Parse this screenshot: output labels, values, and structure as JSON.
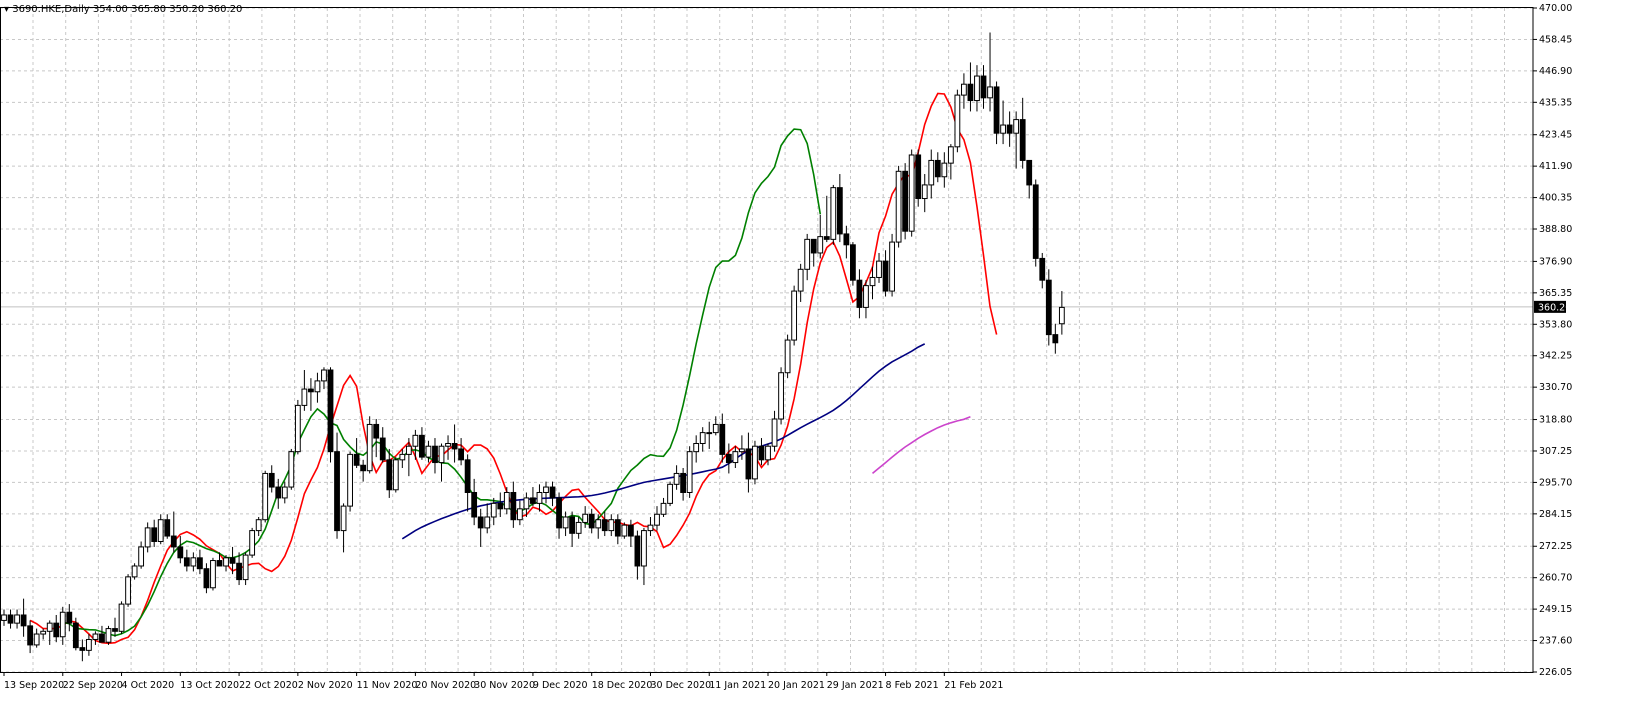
{
  "header": {
    "symbol": "3690.HKE,Daily",
    "ohlc": "354.00 365.80 350.20 360.20"
  },
  "colors": {
    "background": "#ffffff",
    "grid": "#c8c8c8",
    "candle_up_fill": "#ffffff",
    "candle_down_fill": "#000000",
    "candle_stroke": "#000000",
    "ma_fast": "#ff0000",
    "ma_mid": "#008000",
    "ma_slow": "#000080",
    "ma_long": "#cc44cc",
    "price_line": "#c0c0c0",
    "price_label_bg": "#000000",
    "price_label_text": "#ffffff"
  },
  "chart_data": {
    "type": "candlestick",
    "title": "3690.HKE,Daily",
    "ylim": [
      226.05,
      470.0
    ],
    "y_ticks": [
      "470.00",
      "458.45",
      "446.90",
      "435.35",
      "423.45",
      "411.90",
      "400.35",
      "388.80",
      "376.90",
      "365.35",
      "353.80",
      "342.25",
      "330.70",
      "318.80",
      "307.25",
      "295.70",
      "284.15",
      "272.25",
      "260.70",
      "249.15",
      "237.60",
      "226.05"
    ],
    "x_labels": [
      "13 Sep 2020",
      "22 Sep 2020",
      "4 Oct 2020",
      "13 Oct 2020",
      "22 Oct 2020",
      "2 Nov 2020",
      "11 Nov 2020",
      "20 Nov 2020",
      "30 Nov 2020",
      "9 Dec 2020",
      "18 Dec 2020",
      "30 Dec 2020",
      "11 Jan 2021",
      "20 Jan 2021",
      "29 Jan 2021",
      "8 Feb 2021",
      "21 Feb 2021"
    ],
    "x_label_bar_index": [
      0,
      9,
      18,
      27,
      36,
      45,
      54,
      63,
      72,
      81,
      90,
      99,
      108,
      117,
      126,
      135,
      144
    ],
    "current_price": 360.2,
    "grid": true,
    "candles": [
      [
        245,
        249,
        243,
        247
      ],
      [
        247,
        249,
        242,
        244
      ],
      [
        244,
        249,
        242,
        247
      ],
      [
        247,
        253,
        239,
        243
      ],
      [
        243,
        245,
        233,
        236
      ],
      [
        236,
        242,
        235,
        240
      ],
      [
        240,
        242,
        238,
        241
      ],
      [
        241,
        245,
        236,
        244
      ],
      [
        244,
        247,
        237,
        239
      ],
      [
        239,
        250,
        236,
        248
      ],
      [
        248,
        251,
        241,
        244
      ],
      [
        244,
        246,
        234,
        235
      ],
      [
        235,
        238,
        230,
        234
      ],
      [
        234,
        240,
        232,
        238
      ],
      [
        238,
        241,
        236,
        240
      ],
      [
        240,
        243,
        237,
        237
      ],
      [
        237,
        243,
        236,
        242
      ],
      [
        242,
        246,
        239,
        241
      ],
      [
        241,
        252,
        240,
        251
      ],
      [
        251,
        262,
        250,
        261
      ],
      [
        261,
        266,
        260,
        265
      ],
      [
        265,
        274,
        264,
        272
      ],
      [
        272,
        281,
        270,
        279
      ],
      [
        279,
        282,
        272,
        274
      ],
      [
        274,
        284,
        273,
        282
      ],
      [
        282,
        284,
        275,
        276
      ],
      [
        276,
        285,
        270,
        272
      ],
      [
        272,
        276,
        266,
        268
      ],
      [
        268,
        271,
        263,
        265
      ],
      [
        265,
        270,
        263,
        268
      ],
      [
        268,
        271,
        262,
        264
      ],
      [
        264,
        266,
        255,
        257
      ],
      [
        257,
        268,
        256,
        267
      ],
      [
        267,
        270,
        265,
        265
      ],
      [
        265,
        269,
        263,
        268
      ],
      [
        268,
        272,
        262,
        266
      ],
      [
        266,
        270,
        258,
        260
      ],
      [
        260,
        270,
        258,
        269
      ],
      [
        269,
        279,
        268,
        278
      ],
      [
        278,
        283,
        276,
        282
      ],
      [
        282,
        300,
        281,
        299
      ],
      [
        299,
        302,
        292,
        294
      ],
      [
        294,
        297,
        286,
        290
      ],
      [
        290,
        296,
        288,
        294
      ],
      [
        294,
        308,
        293,
        307
      ],
      [
        307,
        326,
        306,
        324
      ],
      [
        324,
        337,
        322,
        330
      ],
      [
        330,
        334,
        322,
        329
      ],
      [
        329,
        336,
        325,
        333
      ],
      [
        333,
        338,
        330,
        337
      ],
      [
        337,
        338,
        303,
        307
      ],
      [
        307,
        314,
        275,
        278
      ],
      [
        278,
        288,
        270,
        287
      ],
      [
        287,
        307,
        285,
        306
      ],
      [
        306,
        312,
        301,
        302
      ],
      [
        302,
        304,
        296,
        300
      ],
      [
        300,
        320,
        299,
        317
      ],
      [
        317,
        319,
        305,
        312
      ],
      [
        312,
        316,
        303,
        304
      ],
      [
        304,
        308,
        290,
        293
      ],
      [
        293,
        305,
        292,
        304
      ],
      [
        304,
        308,
        301,
        306
      ],
      [
        306,
        312,
        298,
        309
      ],
      [
        309,
        315,
        304,
        313
      ],
      [
        313,
        316,
        304,
        305
      ],
      [
        305,
        311,
        303,
        309
      ],
      [
        309,
        312,
        299,
        303
      ],
      [
        303,
        310,
        296,
        309
      ],
      [
        309,
        313,
        304,
        310
      ],
      [
        310,
        317,
        303,
        308
      ],
      [
        308,
        312,
        302,
        304
      ],
      [
        304,
        306,
        285,
        292
      ],
      [
        292,
        297,
        280,
        283
      ],
      [
        283,
        286,
        272,
        279
      ],
      [
        279,
        288,
        277,
        283
      ],
      [
        283,
        290,
        280,
        288
      ],
      [
        288,
        292,
        283,
        286
      ],
      [
        286,
        294,
        284,
        292
      ],
      [
        292,
        296,
        279,
        282
      ],
      [
        282,
        289,
        280,
        286
      ],
      [
        286,
        292,
        283,
        290
      ],
      [
        290,
        294,
        287,
        288
      ],
      [
        288,
        295,
        285,
        292
      ],
      [
        292,
        296,
        288,
        294
      ],
      [
        294,
        296,
        287,
        290
      ],
      [
        290,
        292,
        275,
        279
      ],
      [
        279,
        285,
        276,
        283
      ],
      [
        283,
        285,
        272,
        277
      ],
      [
        277,
        283,
        275,
        281
      ],
      [
        281,
        287,
        279,
        284
      ],
      [
        284,
        286,
        277,
        279
      ],
      [
        279,
        284,
        275,
        282
      ],
      [
        282,
        285,
        276,
        278
      ],
      [
        278,
        284,
        276,
        282
      ],
      [
        282,
        284,
        273,
        276
      ],
      [
        276,
        281,
        275,
        280
      ],
      [
        280,
        282,
        272,
        276
      ],
      [
        276,
        278,
        260,
        265
      ],
      [
        265,
        279,
        258,
        278
      ],
      [
        278,
        283,
        276,
        280
      ],
      [
        280,
        287,
        278,
        284
      ],
      [
        284,
        290,
        283,
        288
      ],
      [
        288,
        296,
        287,
        295
      ],
      [
        295,
        302,
        293,
        299
      ],
      [
        299,
        301,
        289,
        292
      ],
      [
        292,
        309,
        290,
        307
      ],
      [
        307,
        313,
        303,
        310
      ],
      [
        310,
        316,
        307,
        314
      ],
      [
        314,
        318,
        308,
        314
      ],
      [
        314,
        320,
        313,
        317
      ],
      [
        317,
        321,
        303,
        306
      ],
      [
        306,
        310,
        299,
        303
      ],
      [
        303,
        309,
        301,
        307
      ],
      [
        307,
        313,
        304,
        308
      ],
      [
        308,
        314,
        292,
        297
      ],
      [
        297,
        311,
        295,
        309
      ],
      [
        309,
        312,
        302,
        304
      ],
      [
        304,
        310,
        302,
        309
      ],
      [
        309,
        322,
        307,
        319
      ],
      [
        319,
        338,
        317,
        336
      ],
      [
        336,
        350,
        334,
        348
      ],
      [
        348,
        368,
        346,
        366
      ],
      [
        366,
        376,
        362,
        374
      ],
      [
        374,
        387,
        370,
        385
      ],
      [
        385,
        384,
        375,
        380
      ],
      [
        380,
        394,
        378,
        386
      ],
      [
        386,
        401,
        384,
        385
      ],
      [
        385,
        405,
        383,
        404
      ],
      [
        404,
        409,
        384,
        387
      ],
      [
        387,
        390,
        378,
        383
      ],
      [
        383,
        384,
        368,
        370
      ],
      [
        370,
        374,
        356,
        360
      ],
      [
        360,
        370,
        356,
        368
      ],
      [
        368,
        375,
        363,
        371
      ],
      [
        371,
        380,
        369,
        377
      ],
      [
        377,
        381,
        364,
        366
      ],
      [
        366,
        387,
        364,
        384
      ],
      [
        384,
        412,
        382,
        410
      ],
      [
        410,
        413,
        385,
        388
      ],
      [
        388,
        418,
        386,
        416
      ],
      [
        416,
        418,
        397,
        400
      ],
      [
        400,
        409,
        395,
        405
      ],
      [
        405,
        418,
        400,
        414
      ],
      [
        414,
        417,
        406,
        408
      ],
      [
        408,
        417,
        404,
        413
      ],
      [
        413,
        420,
        407,
        419
      ],
      [
        419,
        440,
        417,
        438
      ],
      [
        438,
        446,
        433,
        442
      ],
      [
        442,
        450,
        432,
        436
      ],
      [
        436,
        449,
        432,
        445
      ],
      [
        445,
        449,
        433,
        437
      ],
      [
        437,
        461,
        432,
        441
      ],
      [
        441,
        443,
        420,
        424
      ],
      [
        424,
        436,
        420,
        427
      ],
      [
        427,
        432,
        419,
        424
      ],
      [
        424,
        432,
        411,
        429
      ],
      [
        429,
        437,
        411,
        414
      ],
      [
        414,
        413,
        400,
        405
      ],
      [
        405,
        407,
        375,
        378
      ],
      [
        378,
        380,
        367,
        370
      ],
      [
        370,
        374,
        346,
        350
      ],
      [
        350,
        354,
        343,
        347
      ],
      [
        354,
        366,
        350,
        360
      ]
    ],
    "series": [
      {
        "color_key": "ma_fast",
        "start_index": 4,
        "values": [
          245.0,
          243.8,
          242.0,
          242.0,
          242.0,
          243.2,
          244.8,
          244.4,
          242.2,
          240.0,
          237.6,
          236.8,
          236.6,
          236.8,
          238.0,
          238.8,
          241.6,
          246.4,
          252.4,
          259.0,
          265.0,
          270.8,
          274.0,
          276.6,
          277.6,
          276.4,
          274.8,
          272.4,
          271.0,
          269.6,
          266.0,
          263.2,
          264.2,
          265.0,
          265.8,
          266.0,
          264.0,
          263.0,
          264.8,
          268.6,
          274.4,
          282.8,
          291.6,
          296.6,
          301.2,
          308.0,
          316.4,
          323.8,
          331.4,
          335.0,
          331.0,
          316.8,
          305.6,
          299.4,
          303.4,
          303.8,
          305.4,
          308.0,
          310.4,
          305.2,
          299.0,
          302.2,
          305.4,
          305.4,
          307.6,
          309.6,
          309.4,
          307.0,
          309.4,
          309.4,
          308.0,
          304.6,
          298.8,
          292.2,
          286.2,
          283.0,
          283.8,
          286.6,
          285.8,
          284.0,
          285.2,
          288.0,
          290.6,
          292.8,
          293.2,
          290.2,
          287.6,
          285.0,
          282.0,
          281.0,
          281.2,
          280.2,
          279.8,
          281.0,
          279.6,
          279.4,
          277.6,
          271.8,
          273.0,
          276.2,
          280.0,
          284.4,
          290.6,
          295.4,
          298.6,
          300.0,
          304.0,
          307.0,
          309.0,
          307.0,
          306.8,
          305.2,
          301.2,
          304.0,
          304.4,
          309.4,
          316.4,
          326.4,
          339.2,
          354.4,
          366.8,
          376.4,
          382.0,
          384.0,
          378.8,
          370.4,
          362.0,
          364.0,
          369.2,
          374.8,
          387.4,
          393.6,
          401.6,
          405.6,
          408.8,
          408.0,
          417.0,
          427.2,
          434.0,
          438.6,
          438.4,
          433.6,
          425.6,
          421.6,
          413.2,
          397.0,
          379.2,
          360.4,
          350.0
        ]
      },
      {
        "color_key": "ma_mid",
        "start_index": 9,
        "values": [
          244.3,
          243.8,
          242.1,
          241.8,
          241.6,
          241.5,
          240.8,
          240.0,
          239.4,
          240.1,
          241.3,
          242.9,
          246.3,
          250.6,
          255.6,
          261.1,
          266.0,
          270.0,
          272.6,
          274.1,
          273.6,
          272.5,
          271.4,
          270.6,
          269.6,
          268.1,
          268.0,
          268.7,
          270.0,
          271.7,
          274.2,
          278.6,
          285.3,
          292.3,
          296.8,
          301.9,
          310.2,
          315.1,
          319.8,
          322.7,
          320.8,
          317.6,
          316.6,
          311.5,
          308.8,
          306.5,
          305.7,
          307.6,
          310.6,
          309.8,
          306.4,
          304.2,
          304.8,
          307.4,
          307.7,
          306.9,
          304.7,
          303.8,
          302.9,
          302.7,
          300.6,
          297.6,
          294.2,
          290.8,
          289.3,
          289.3,
          289.0,
          288.7,
          286.6,
          285.3,
          285.1,
          286.2,
          287.8,
          288.5,
          287.4,
          285.4,
          283.5,
          282.6,
          283.6,
          283.2,
          280.6,
          280.2,
          282.4,
          285.2,
          288.0,
          293.5,
          296.9,
          300.1,
          302.1,
          304.5,
          305.9,
          305.4,
          305.3,
          308.4,
          314.8,
          324.1,
          334.9,
          346.7,
          357.3,
          367.4,
          374.7,
          377.0,
          377.1,
          379.1,
          385.5,
          394.8,
          402.1,
          405.6,
          408.1,
          411.5,
          419.5,
          423.0,
          425.5,
          425.3,
          420.2,
          408.8,
          394.2
        ]
      },
      {
        "color_key": "ma_slow",
        "start_index": 61,
        "values": [
          275.0,
          276.5,
          278.0,
          279.3,
          280.4,
          281.4,
          282.4,
          283.3,
          284.2,
          285.0,
          285.8,
          286.5,
          287.1,
          287.6,
          288.1,
          288.5,
          288.8,
          289.1,
          289.3,
          289.5,
          289.7,
          289.8,
          289.9,
          290.0,
          290.1,
          290.2,
          290.3,
          290.4,
          290.6,
          290.9,
          291.3,
          291.8,
          292.4,
          293.0,
          293.7,
          294.4,
          295.1,
          295.7,
          296.2,
          296.6,
          297.0,
          297.4,
          297.8,
          298.2,
          298.6,
          299.1,
          299.6,
          300.1,
          300.6,
          301.3,
          302.6,
          304.4,
          306.0,
          307.4,
          308.3,
          309.0,
          309.8,
          310.6,
          311.7,
          313.0,
          314.4,
          315.8,
          317.1,
          318.3,
          319.5,
          320.8,
          322.2,
          323.9,
          325.8,
          327.9,
          330.1,
          332.3,
          334.5,
          336.6,
          338.4,
          340.0,
          341.3,
          342.6,
          343.9,
          345.4,
          346.6
        ]
      },
      {
        "color_key": "ma_long",
        "start_index": 133,
        "values": [
          299.0,
          301.0,
          303.0,
          305.0,
          306.9,
          308.7,
          310.3,
          311.9,
          313.3,
          314.6,
          315.8,
          316.8,
          317.6,
          318.3,
          318.9,
          319.8
        ]
      }
    ]
  }
}
